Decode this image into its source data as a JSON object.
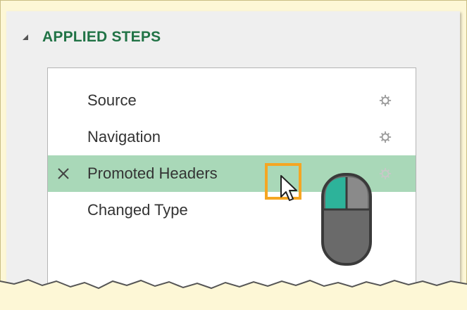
{
  "applied_steps": {
    "title": "APPLIED STEPS",
    "steps": [
      {
        "label": "Source"
      },
      {
        "label": "Navigation"
      },
      {
        "label": "Promoted Headers"
      },
      {
        "label": "Changed Type"
      }
    ],
    "selected_index": 2
  },
  "icons": {
    "collapse": "collapse-triangle-icon",
    "gear": "gear-icon",
    "delete": "close-x-icon",
    "cursor": "mouse-pointer-icon",
    "mouse": "mouse-left-click-icon"
  },
  "colors": {
    "title": "#217346",
    "selected_row": "#a9d8b8",
    "highlight": "#f5a623",
    "mouse_left_button": "#2db39a",
    "background": "#fdf7d6"
  }
}
